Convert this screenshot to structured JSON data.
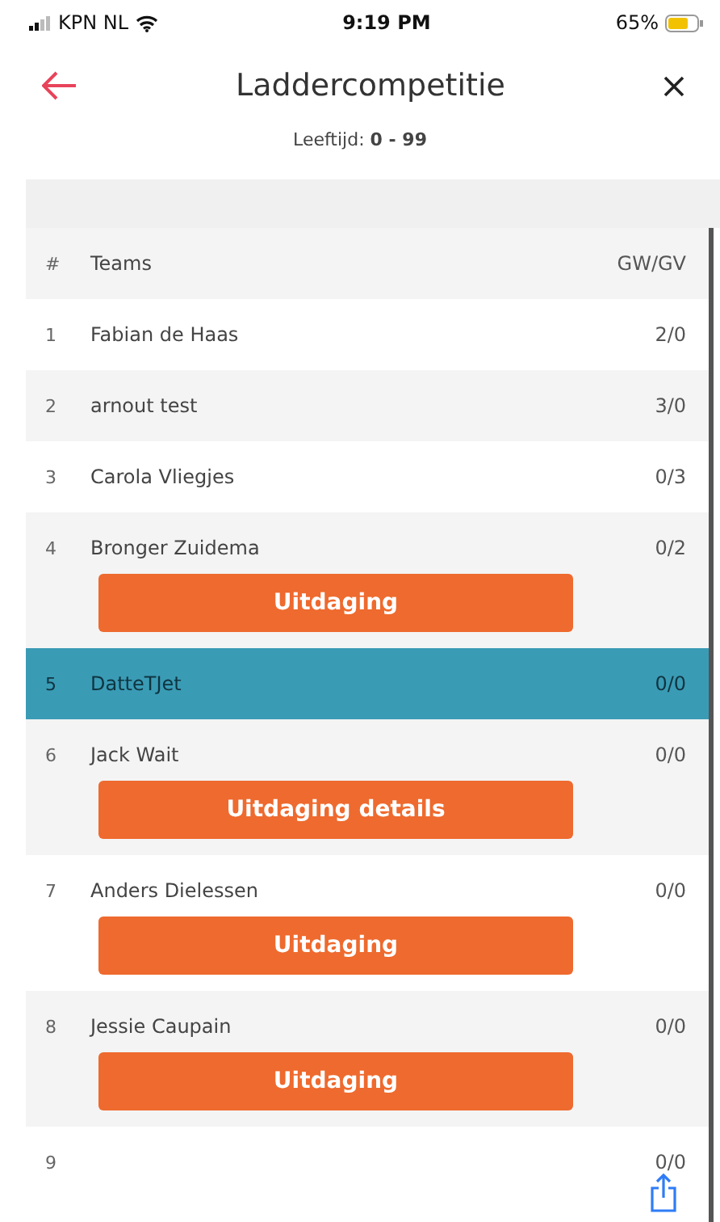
{
  "status_bar": {
    "carrier": "KPN NL",
    "time": "9:19 PM",
    "battery": "65%"
  },
  "header": {
    "title": "Laddercompetitie",
    "subtitle": "Leeftijd: **0 - 99**"
  },
  "table": {
    "columns": [
      "#",
      "Teams",
      "GW/GV"
    ],
    "rows": [
      {
        "rank": "1",
        "team": "Fabian de Haas",
        "score": "2/0",
        "selected": false
      },
      {
        "rank": "2",
        "team": "arnout test",
        "score": "3/0",
        "selected": false
      },
      {
        "rank": "3",
        "team": "Carola Vliegjes",
        "score": "0/3",
        "selected": false
      },
      {
        "rank": "4",
        "team": "Bronger Zuidema",
        "score": "0/2",
        "selected": false,
        "action": "Uitdaging"
      },
      {
        "rank": "5",
        "team": "DatteTJet",
        "score": "0/0",
        "selected": true
      },
      {
        "rank": "6",
        "team": "Jack Wait",
        "score": "0/0",
        "selected": false,
        "action": "Uitdaging details"
      },
      {
        "rank": "7",
        "team": "Anders Dielessen",
        "score": "0/0",
        "selected": false,
        "action": "Uitdaging"
      },
      {
        "rank": "8",
        "team": "Jessie Caupain",
        "score": "0/0",
        "selected": false,
        "action": "Uitdaging"
      },
      {
        "rank": "9",
        "score": "0/0",
        "selected": false
      }
    ]
  }
}
